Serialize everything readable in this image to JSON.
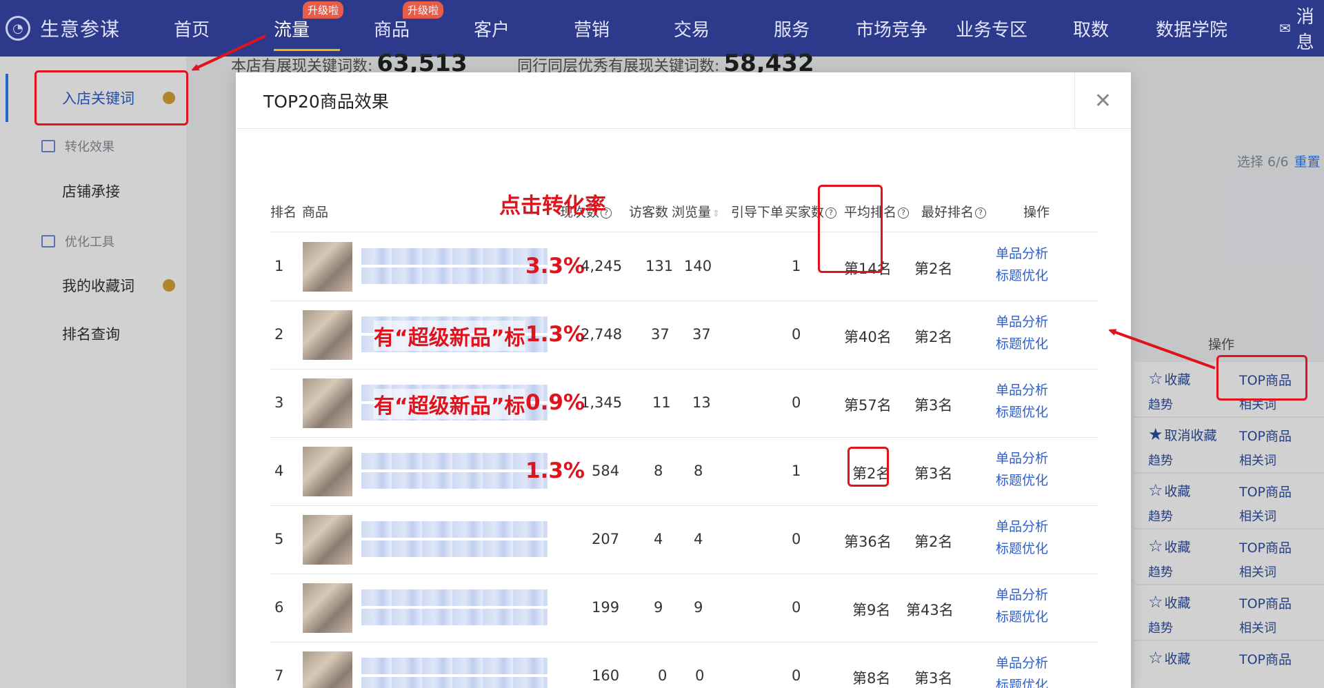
{
  "topnav": {
    "logo_text": "生意参谋",
    "items": [
      {
        "label": "首页",
        "badge": ""
      },
      {
        "label": "流量",
        "badge": "升级啦"
      },
      {
        "label": "商品",
        "badge": "升级啦"
      },
      {
        "label": "客户",
        "badge": ""
      },
      {
        "label": "营销",
        "badge": ""
      },
      {
        "label": "交易",
        "badge": ""
      },
      {
        "label": "服务",
        "badge": ""
      },
      {
        "label": "市场竞争",
        "badge": ""
      },
      {
        "label": "业务专区",
        "badge": ""
      },
      {
        "label": "取数",
        "badge": ""
      },
      {
        "label": "数据学院",
        "badge": ""
      },
      {
        "label": "消息",
        "badge": ""
      }
    ],
    "message_icon": "envelope-icon"
  },
  "sidebar": {
    "items": [
      {
        "label": "入店关键词",
        "type": "item"
      },
      {
        "label": "转化效果",
        "type": "group"
      },
      {
        "label": "店铺承接",
        "type": "item"
      },
      {
        "label": "优化工具",
        "type": "group"
      },
      {
        "label": "我的收藏词",
        "type": "item"
      },
      {
        "label": "排名查询",
        "type": "item"
      }
    ]
  },
  "background": {
    "stat1_label": "本店有展现关键词数:",
    "stat1_value": "63,513",
    "stat2_label": "同行同层优秀有展现关键词数:",
    "stat2_value": "58,432",
    "select_text": "选择 6/6",
    "reset_text": "重置",
    "op_header": "操作",
    "rows": [
      {
        "fav": "收藏",
        "trend": "趋势",
        "top": "TOP商品",
        "related": "相关词",
        "filled": false
      },
      {
        "fav": "取消收藏",
        "trend": "趋势",
        "top": "TOP商品",
        "related": "相关词",
        "filled": true
      },
      {
        "fav": "收藏",
        "trend": "趋势",
        "top": "TOP商品",
        "related": "相关词",
        "filled": false
      },
      {
        "fav": "收藏",
        "trend": "趋势",
        "top": "TOP商品",
        "related": "相关词",
        "filled": false
      },
      {
        "fav": "收藏",
        "trend": "趋势",
        "top": "TOP商品",
        "related": "相关词",
        "filled": false
      },
      {
        "fav": "收藏",
        "trend": "趋势",
        "top": "TOP商品",
        "related": "",
        "filled": false
      }
    ]
  },
  "modal": {
    "title": "TOP20商品效果",
    "close_icon": "close-icon",
    "headers": {
      "rank": "排名",
      "product": "商品",
      "impressions": "现次数",
      "visitors": "访客数",
      "pageviews": "浏览量",
      "orders": "引导下单",
      "buyers": "买家数",
      "avg_rank": "平均排名",
      "best_rank": "最好排名",
      "ops": "操作"
    },
    "ops_labels": {
      "analyze": "单品分析",
      "optimize": "标题优化"
    },
    "rows": [
      {
        "rank": "1",
        "conv": "3.3%",
        "impressions": "4,245",
        "visitors": "131",
        "pageviews": "140",
        "buyers": "1",
        "avg_rank": "第14名",
        "best_rank": "第2名",
        "note": ""
      },
      {
        "rank": "2",
        "conv": "1.3%",
        "impressions": "2,748",
        "visitors": "37",
        "pageviews": "37",
        "buyers": "0",
        "avg_rank": "第40名",
        "best_rank": "第2名",
        "note": "有“超级新品”标"
      },
      {
        "rank": "3",
        "conv": "0.9%",
        "impressions": "1,345",
        "visitors": "11",
        "pageviews": "13",
        "buyers": "0",
        "avg_rank": "第57名",
        "best_rank": "第3名",
        "note": "有“超级新品”标"
      },
      {
        "rank": "4",
        "conv": "1.3%",
        "impressions": "584",
        "visitors": "8",
        "pageviews": "8",
        "buyers": "1",
        "avg_rank": "第2名",
        "best_rank": "第3名",
        "note": ""
      },
      {
        "rank": "5",
        "conv": "",
        "impressions": "207",
        "visitors": "4",
        "pageviews": "4",
        "buyers": "0",
        "avg_rank": "第36名",
        "best_rank": "第2名",
        "note": ""
      },
      {
        "rank": "6",
        "conv": "",
        "impressions": "199",
        "visitors": "9",
        "pageviews": "9",
        "buyers": "0",
        "avg_rank": "第9名",
        "best_rank": "第43名",
        "note": ""
      },
      {
        "rank": "7",
        "conv": "",
        "impressions": "160",
        "visitors": "0",
        "pageviews": "0",
        "buyers": "0",
        "avg_rank": "第8名",
        "best_rank": "第3名",
        "note": ""
      }
    ]
  },
  "annotations": {
    "click_conversion": "点击转化率",
    "color": "#e0121b"
  }
}
